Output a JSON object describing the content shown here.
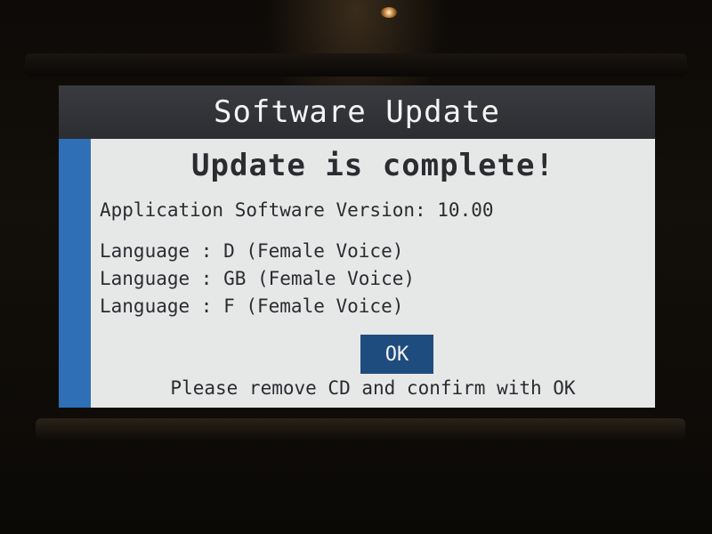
{
  "window": {
    "title": "Software Update"
  },
  "dialog": {
    "headline": "Update is complete!",
    "version_line": "Application Software Version: 10.00",
    "languages": [
      "Language : D (Female Voice)",
      "Language : GB (Female Voice)",
      "Language : F (Female Voice)"
    ],
    "ok_label": "OK",
    "hint": "Please remove CD and confirm with OK"
  },
  "colors": {
    "title_bar": "#2e2f33",
    "sidebar_accent": "#2f6fb6",
    "ok_button": "#1f4c7e",
    "screen_background": "#e6e8e8"
  }
}
